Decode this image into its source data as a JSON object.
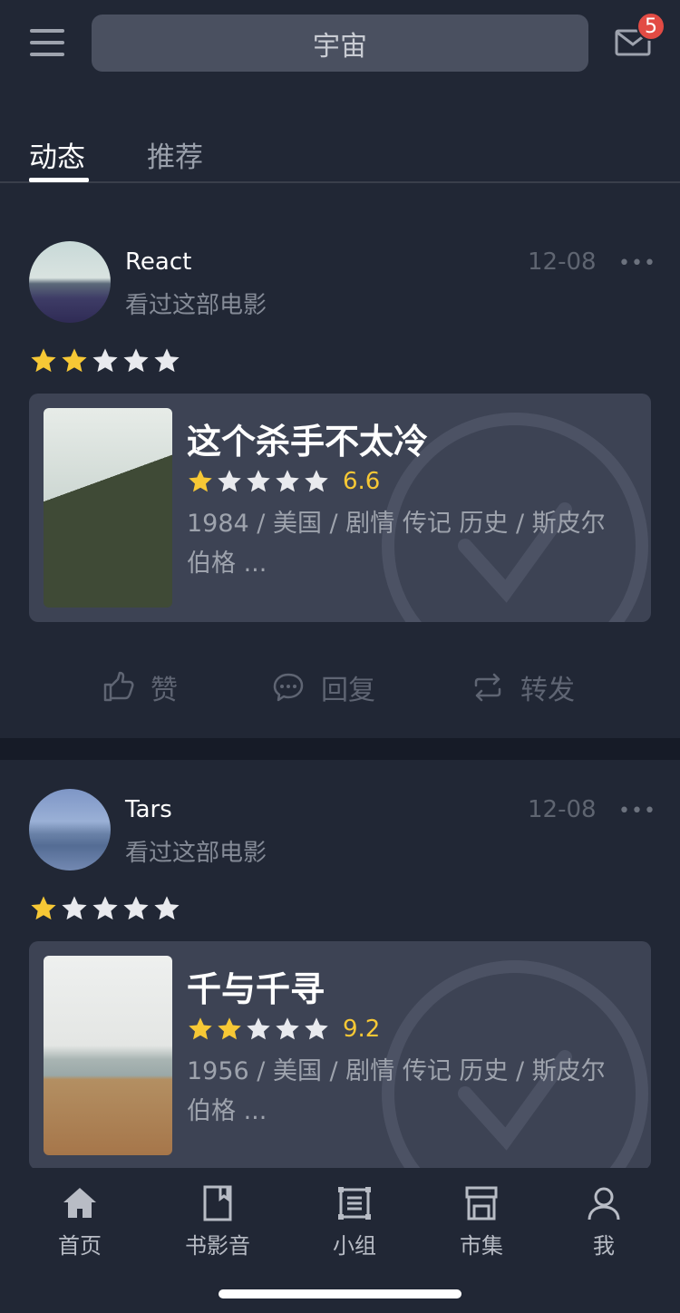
{
  "header": {
    "search_text": "宇宙",
    "mail_badge": "5"
  },
  "tabs": [
    {
      "label": "动态",
      "active": true
    },
    {
      "label": "推荐",
      "active": false
    }
  ],
  "feed": [
    {
      "username": "React",
      "action": "看过这部电影",
      "date": "12-08",
      "more": "•••",
      "user_rating_stars": 2,
      "movie": {
        "title": "这个杀手不太冷",
        "stars": 1,
        "rating": "6.6",
        "meta": "1984 / 美国 / 剧情 传记 历史 / 斯皮尔伯格 ..."
      }
    },
    {
      "username": "Tars",
      "action": "看过这部电影",
      "date": "12-08",
      "more": "•••",
      "user_rating_stars": 1,
      "movie": {
        "title": "千与千寻",
        "stars": 2,
        "rating": "9.2",
        "meta": "1956 / 美国 / 剧情 传记 历史 / 斯皮尔伯格 ..."
      }
    }
  ],
  "post_actions": {
    "like": "赞",
    "reply": "回复",
    "repost": "转发"
  },
  "bottom_nav": [
    {
      "label": "首页",
      "icon": "home-icon"
    },
    {
      "label": "书影音",
      "icon": "book-icon"
    },
    {
      "label": "小组",
      "icon": "group-icon"
    },
    {
      "label": "市集",
      "icon": "market-icon"
    },
    {
      "label": "我",
      "icon": "profile-icon"
    }
  ],
  "colors": {
    "background": "#212735",
    "card": "#3d4354",
    "star_filled": "#f7c835",
    "star_empty": "#e9eaee",
    "badge": "#e24b44"
  }
}
